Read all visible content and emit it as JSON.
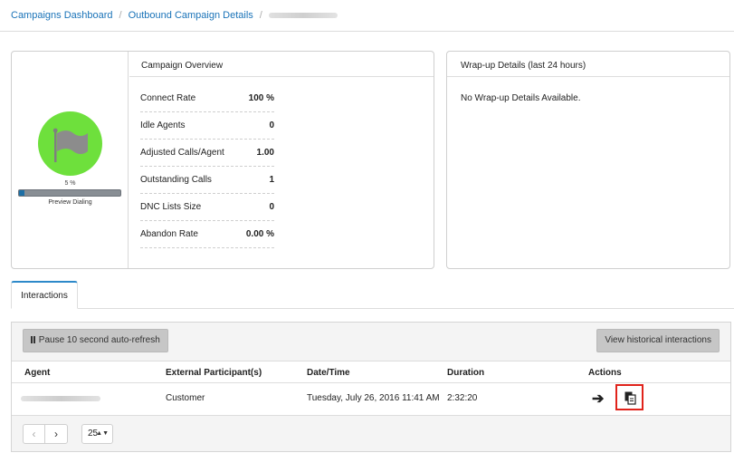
{
  "breadcrumb": {
    "items": [
      "Campaigns Dashboard",
      "Outbound Campaign Details"
    ],
    "separator": "/"
  },
  "indicator": {
    "progress_value": 5,
    "progress_text": "5 %",
    "mode": "Preview Dialing",
    "circle_color": "#6ee03c",
    "bar_color": "#1d6fa5",
    "icon": "flag-icon"
  },
  "overview": {
    "title": "Campaign Overview",
    "stats": [
      {
        "label": "Connect Rate",
        "value": "100 %"
      },
      {
        "label": "Idle Agents",
        "value": "0"
      },
      {
        "label": "Adjusted Calls/Agent",
        "value": "1.00"
      },
      {
        "label": "Outstanding Calls",
        "value": "1"
      },
      {
        "label": "DNC Lists Size",
        "value": "0"
      },
      {
        "label": "Abandon Rate",
        "value": "0.00 %"
      }
    ]
  },
  "wrapup": {
    "title": "Wrap-up Details (last 24 hours)",
    "empty_text": "No Wrap-up Details Available."
  },
  "tabs": [
    {
      "label": "Interactions",
      "active": true
    }
  ],
  "interactions": {
    "pause_button": "Pause 10 second auto-refresh",
    "history_button": "View historical interactions",
    "columns": [
      "Agent",
      "External Participant(s)",
      "Date/Time",
      "Duration",
      "Actions"
    ],
    "rows": [
      {
        "external": "Customer",
        "datetime": "Tuesday, July 26, 2016 11:41 AM",
        "duration": "2:32:20"
      }
    ],
    "actions": {
      "arrow": "➔",
      "arrow_icon": "arrow-right-icon",
      "copy_icon": "copy-icon",
      "highlight_color": "#e0231b"
    },
    "pager": {
      "prev": "‹",
      "next": "›",
      "page_size": "25",
      "caret": "▲▼"
    }
  }
}
